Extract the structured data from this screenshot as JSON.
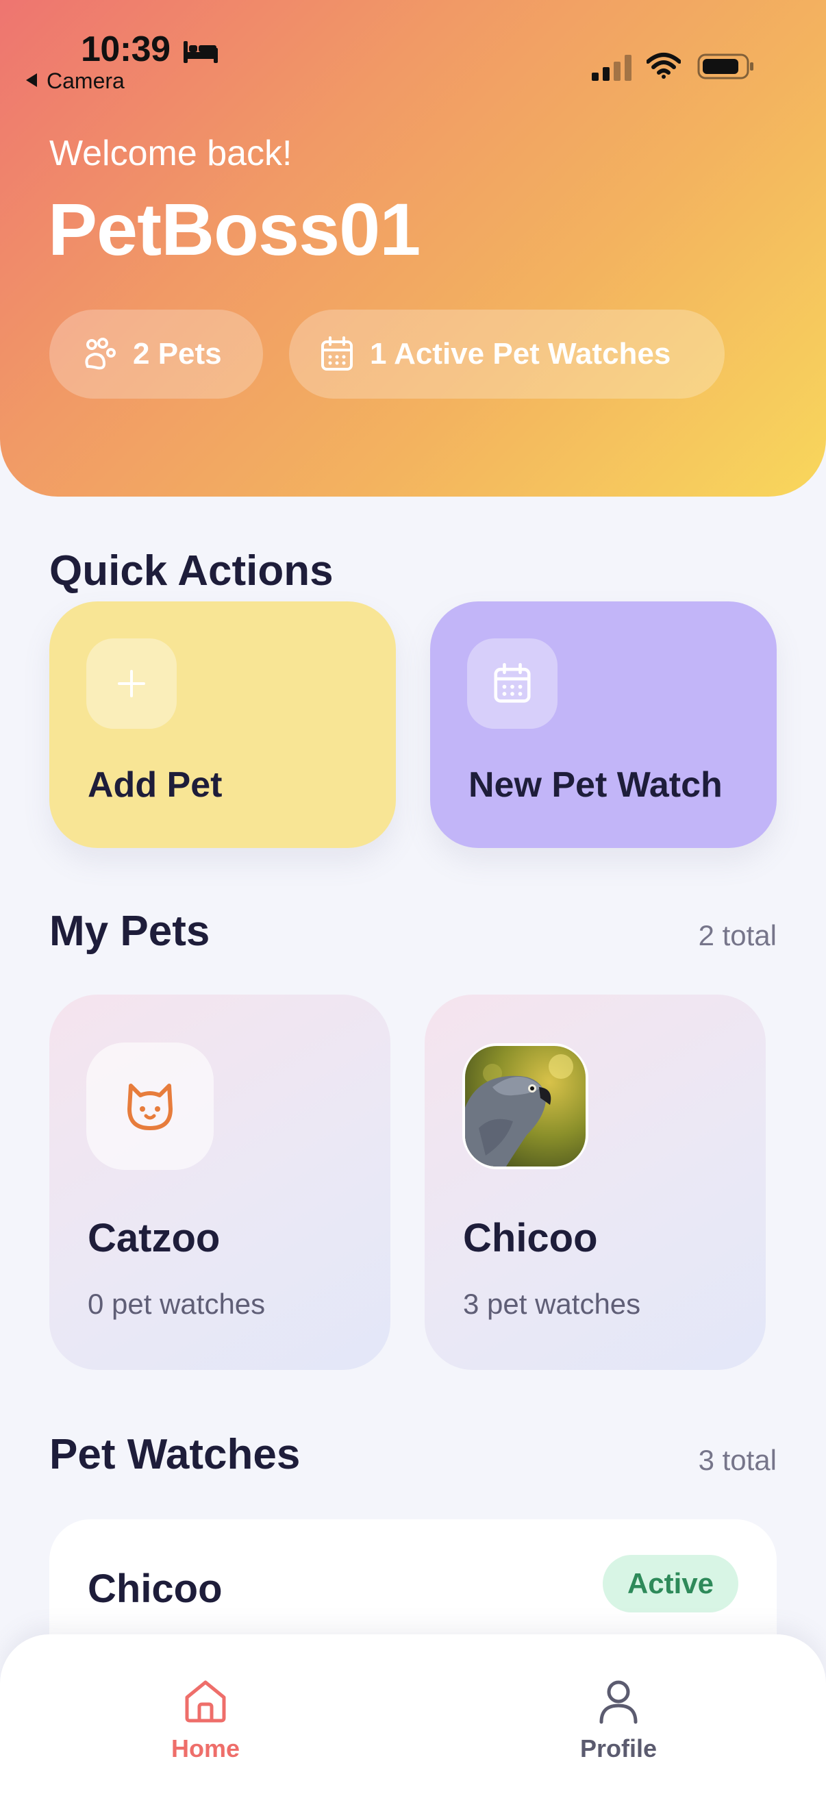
{
  "status_bar": {
    "time": "10:39",
    "back_label": "Camera"
  },
  "header": {
    "welcome": "Welcome back!",
    "username": "PetBoss01",
    "chips": {
      "pets": "2 Pets",
      "watches": "1 Active Pet Watches"
    }
  },
  "quick_actions": {
    "title": "Quick Actions",
    "add_pet": "Add Pet",
    "new_watch": "New Pet Watch"
  },
  "my_pets": {
    "title": "My Pets",
    "count": "2 total",
    "items": [
      {
        "name": "Catzoo",
        "sub": "0 pet watches",
        "icon": "cat-icon"
      },
      {
        "name": "Chicoo",
        "sub": "3 pet watches",
        "icon": "parrot-photo"
      }
    ]
  },
  "pet_watches": {
    "title": "Pet Watches",
    "count": "3 total",
    "items": [
      {
        "name": "Chicoo",
        "status": "Active"
      }
    ]
  },
  "tabbar": {
    "home": "Home",
    "profile": "Profile"
  },
  "colors": {
    "accent_home": "#ee6e6a",
    "add_pet_card": "#f8e595",
    "new_watch_card": "#c2b5f8",
    "active_badge_bg": "#d8f5e5",
    "active_badge_text": "#2e8a5a"
  }
}
